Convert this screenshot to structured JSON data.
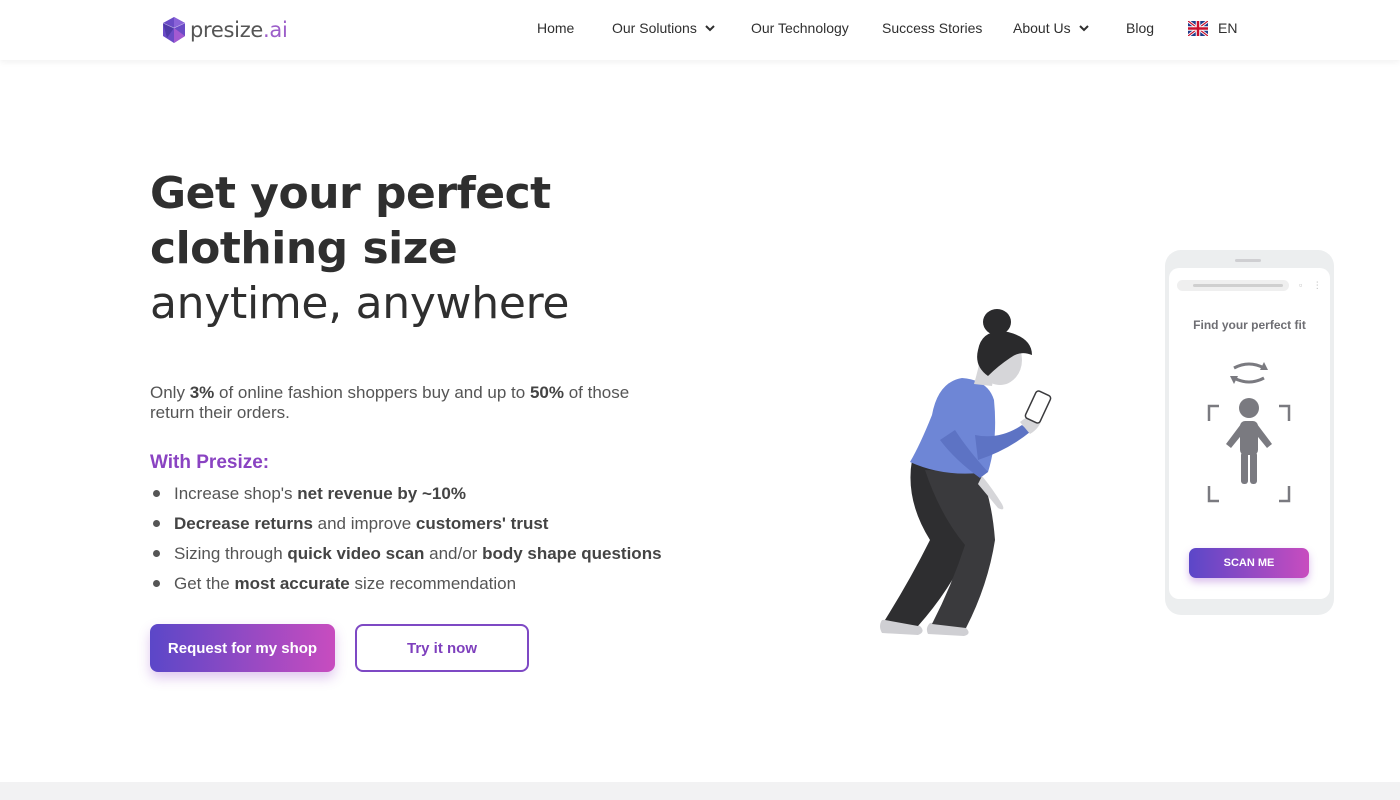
{
  "header": {
    "logo_text_main": "presize",
    "logo_text_suffix": ".ai",
    "nav": [
      {
        "label": "Home",
        "dropdown": false
      },
      {
        "label": "Our Solutions",
        "dropdown": true
      },
      {
        "label": "Our Technology",
        "dropdown": false
      },
      {
        "label": "Success Stories",
        "dropdown": false
      },
      {
        "label": "About Us",
        "dropdown": true
      },
      {
        "label": "Blog",
        "dropdown": false
      }
    ],
    "language": "EN"
  },
  "hero": {
    "title_line1": "Get your perfect",
    "title_line2": "clothing size",
    "title_line3": "anytime, anywhere",
    "intro": {
      "p1": "Only ",
      "b1": "3%",
      "p2": " of online fashion shoppers buy and up to ",
      "b2": "50%",
      "p3": " of those return their orders."
    },
    "with_heading": "With Presize:",
    "bullets": [
      {
        "t1": "Increase shop's ",
        "b1": "net revenue by ~10%",
        "t2": "",
        "b2": ""
      },
      {
        "t1": "",
        "b1": "Decrease returns",
        "t2": " and improve ",
        "b2": "customers' trust"
      },
      {
        "t1": "Sizing through ",
        "b1": "quick video scan",
        "t2": " and/or ",
        "b2": "body shape questions"
      },
      {
        "t1": "Get the ",
        "b1": "most accurate",
        "t2": " size recommendation",
        "b2": ""
      }
    ],
    "cta_primary": "Request for my shop",
    "cta_secondary": "Try it now"
  },
  "phone": {
    "title": "Find your perfect fit",
    "scan_button": "SCAN ME"
  },
  "colors": {
    "accent_purple": "#8a43c2",
    "gradient_start": "#5b47c8",
    "gradient_end": "#c84cbf",
    "shirt_blue": "#6e86d6"
  },
  "icons": {
    "logo": "polyhedron-logo-icon",
    "dropdown": "chevron-down-icon",
    "language": "uk-flag-icon",
    "rotate": "rotate-arrows-icon",
    "body": "person-silhouette-icon"
  }
}
